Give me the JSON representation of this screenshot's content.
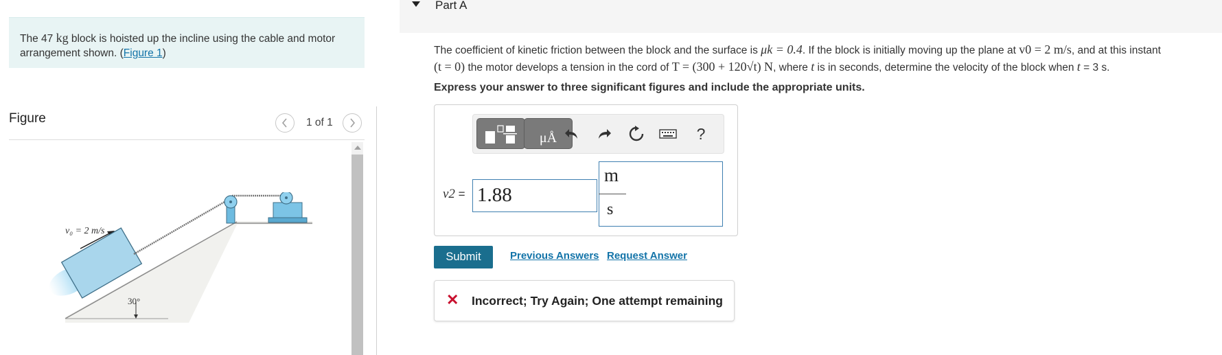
{
  "problem": {
    "intro_prefix": "The 47 ",
    "intro_mass_unit": "kg",
    "intro_suffix": " block is hoisted up the incline using the cable and motor arrangement shown. (",
    "figure_link": "Figure 1",
    "intro_close": ")"
  },
  "figure": {
    "title": "Figure",
    "pager_text": "1 of 1",
    "velocity_label": "v₀ = 2 m/s",
    "angle_label": "30°"
  },
  "part": {
    "label": "Part A",
    "question": {
      "t1": "The coefficient of kinetic friction between the block and the surface is ",
      "mu": "μk = 0.4",
      "t2": ". If the block is initially moving up the plane at ",
      "v0": "v0 = 2 m/s",
      "t3": ", and at this instant",
      "t_zero": "(t = 0)",
      "t4": " the motor develops a tension in the cord of ",
      "tension": "T = (300 + 120√t) N",
      "t5": ", where ",
      "t_var": "t",
      "t6": " is in seconds, determine the velocity of the block when ",
      "t_var2": "t",
      "t7": " = 3 s."
    },
    "instruction": "Express your answer to three significant figures and include the appropriate units."
  },
  "toolbar": {
    "units_button": "μÅ",
    "help": "?"
  },
  "answer": {
    "variable": "v2",
    "equals": "=",
    "value": "1.88",
    "unit_numerator": "m",
    "unit_denominator": "s"
  },
  "actions": {
    "submit": "Submit",
    "previous_answers": "Previous Answers",
    "request_answer": "Request Answer"
  },
  "feedback": {
    "message": "Incorrect; Try Again; One attempt remaining"
  },
  "colors": {
    "accent": "#1a6e8e",
    "link": "#1273a8",
    "intro_bg": "#e8f4f4",
    "error": "#c8102e"
  }
}
